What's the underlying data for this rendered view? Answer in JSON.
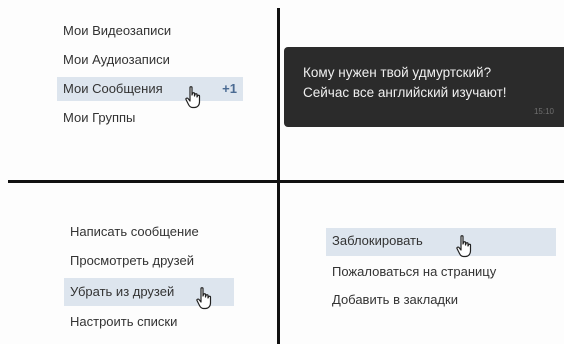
{
  "panel_top_left": {
    "items": [
      {
        "label": "Мои Видеозаписи"
      },
      {
        "label": "Мои Аудиозаписи"
      },
      {
        "label": "Мои Сообщения",
        "count": "+1"
      },
      {
        "label": "Мои Группы"
      }
    ]
  },
  "panel_top_right": {
    "message_line1": "Кому нужен твой удмуртский?",
    "message_line2": "Сейчас все английский изучают!",
    "time": "15:10"
  },
  "panel_bottom_left": {
    "items": [
      {
        "label": "Написать сообщение"
      },
      {
        "label": "Просмотреть друзей"
      },
      {
        "label": "Убрать из друзей"
      },
      {
        "label": "Настроить списки"
      }
    ]
  },
  "panel_bottom_right": {
    "items": [
      {
        "label": "Заблокировать"
      },
      {
        "label": "Пожаловаться на страницу"
      },
      {
        "label": "Добавить в закладки"
      }
    ]
  },
  "colors": {
    "highlight": "#dde5ee",
    "count": "#4a6a92",
    "bubble": "#2b2b2b",
    "divider": "#111111"
  },
  "icons": {
    "cursor": "hand-pointer-icon"
  }
}
